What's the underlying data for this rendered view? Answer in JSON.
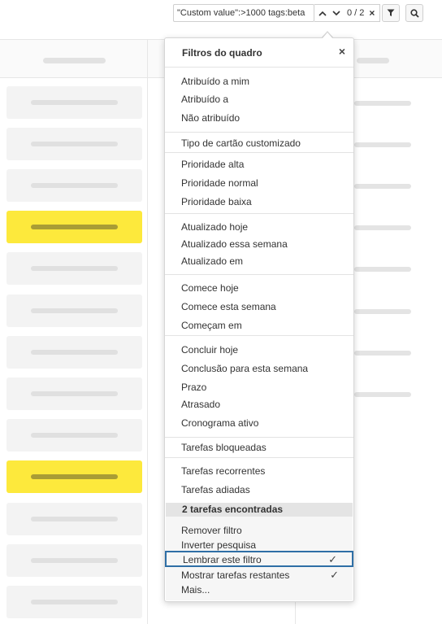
{
  "search": {
    "query": "\"Custom value\":>1000 tags:beta"
  },
  "navigator": {
    "count": "0 / 2"
  },
  "menu": {
    "title": "Filtros do quadro",
    "sections": [
      {
        "items": [
          "Atribuído a mim",
          "Atribuído a",
          "Não atribuído"
        ]
      },
      {
        "items": [
          "Tipo de cartão customizado"
        ]
      },
      {
        "items": [
          "Prioridade alta",
          "Prioridade normal",
          "Prioridade baixa"
        ]
      },
      {
        "items": [
          "Atualizado hoje",
          "Atualizado essa semana",
          "Atualizado em"
        ]
      },
      {
        "items": [
          "Comece hoje",
          "Comece esta semana",
          "Começam em"
        ]
      },
      {
        "items": [
          "Concluir hoje",
          "Conclusão para esta semana",
          "Prazo",
          "Atrasado",
          "Cronograma ativo"
        ]
      },
      {
        "items": [
          "Tarefas bloqueadas"
        ]
      },
      {
        "items": [
          "Tarefas recorrentes",
          "Tarefas adiadas"
        ]
      }
    ],
    "found": "2 tarefas encontradas",
    "actions": {
      "remove": "Remover filtro",
      "invert": "Inverter pesquisa",
      "remember": "Lembrar este filtro",
      "remember_checked": "✓",
      "show_remaining": "Mostrar tarefas restantes",
      "show_remaining_checked": "✓",
      "more": "Mais..."
    }
  }
}
